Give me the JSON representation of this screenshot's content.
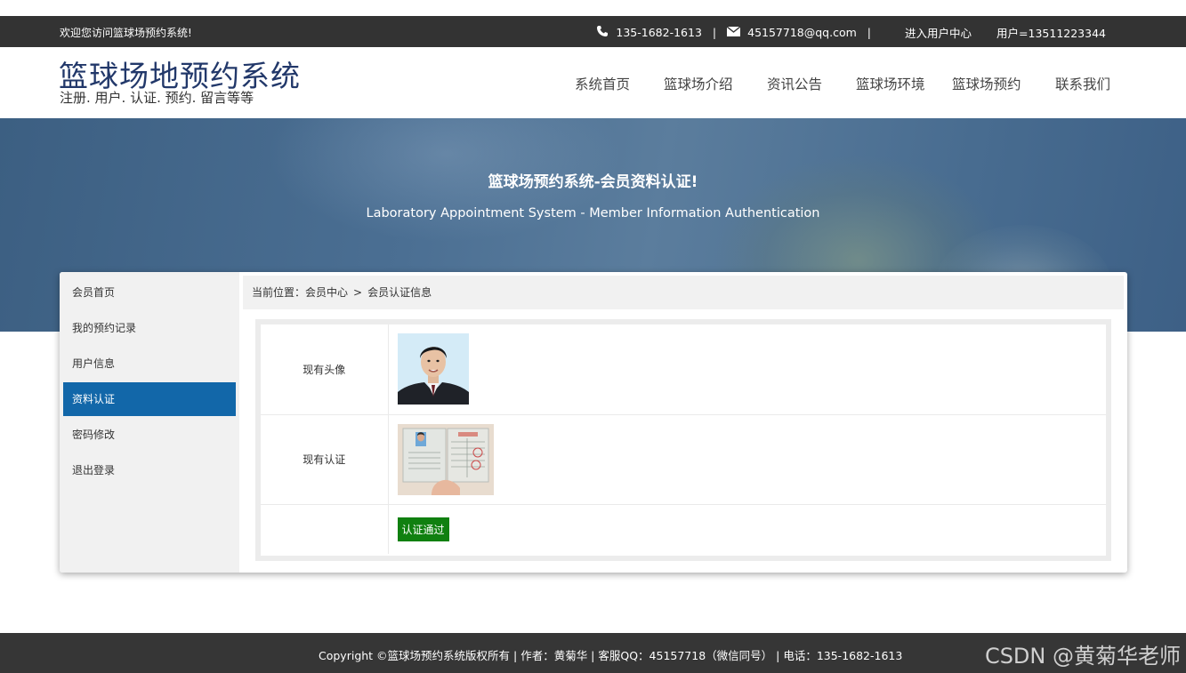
{
  "topbar": {
    "welcome": "欢迎您访问篮球场预约系统!",
    "phone": "135-1682-1613",
    "sep1": "|",
    "email": "45157718@qq.com",
    "sep2": "|",
    "user_center": "进入用户中心",
    "user": "用户=13511223344",
    "icons": [
      "phone-icon",
      "mail-icon"
    ]
  },
  "header": {
    "title": "篮球场地预约系统",
    "subtitle": "注册. 用户. 认证. 预约. 留言等等",
    "nav": [
      "系统首页",
      "篮球场介绍",
      "资讯公告",
      "篮球场环境",
      "篮球场预约",
      "联系我们"
    ]
  },
  "banner": {
    "title": "篮球场预约系统-会员资料认证!",
    "subtitle": "Laboratory Appointment System - Member Information Authentication"
  },
  "sidebar": {
    "items": [
      "会员首页",
      "我的预约记录",
      "用户信息",
      "资料认证",
      "密码修改",
      "退出登录"
    ],
    "active_index": 3,
    "active_color": "#1267a9"
  },
  "breadcrumb": {
    "prefix": "当前位置：",
    "level1": "会员中心",
    "separator": ">",
    "level2": "会员认证信息"
  },
  "auth_table": {
    "avatar_label": "现有头像",
    "cert_label": "现有认证",
    "status_button": "认证通过",
    "status_color": "#108010"
  },
  "footer": {
    "copyright": "Copyright ©篮球场预约系统版权所有 | 作者：黄菊华 | 客服QQ：45157718（微信同号） | 电话：135-1682-1613",
    "watermark": "CSDN @黄菊华老师"
  }
}
